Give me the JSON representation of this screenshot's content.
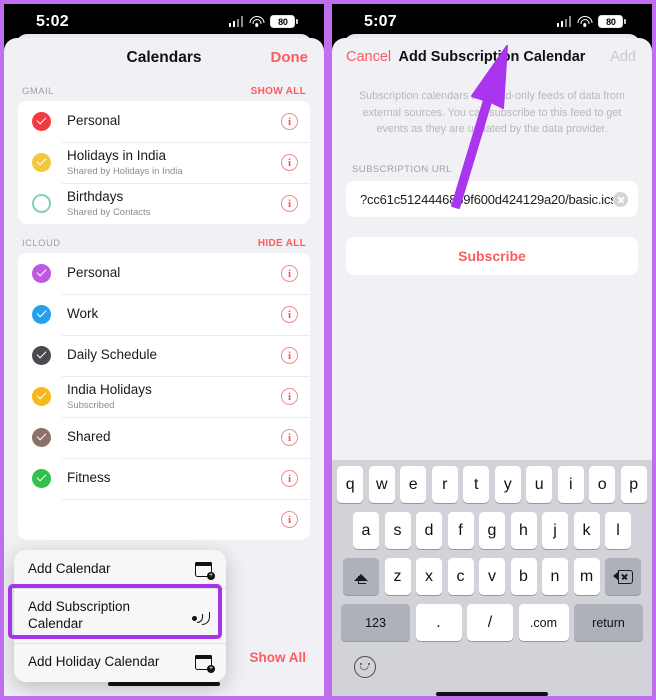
{
  "left": {
    "status": {
      "time": "5:02",
      "battery": "80"
    },
    "nav": {
      "title": "Calendars",
      "done": "Done"
    },
    "sections": [
      {
        "label": "GMAIL",
        "action": "SHOW ALL",
        "rows": [
          {
            "name": "Personal",
            "sub": "",
            "color": "#f33a3f",
            "checked": true
          },
          {
            "name": "Holidays in India",
            "sub": "Shared by Holidays in India",
            "color": "#f2c83c",
            "checked": true
          },
          {
            "name": "Birthdays",
            "sub": "Shared by Contacts",
            "color": "#7fd1bd",
            "checked": false
          }
        ]
      },
      {
        "label": "ICLOUD",
        "action": "HIDE ALL",
        "rows": [
          {
            "name": "Personal",
            "sub": "",
            "color": "#bd5ae0",
            "checked": true
          },
          {
            "name": "Work",
            "sub": "",
            "color": "#22a1ef",
            "checked": true
          },
          {
            "name": "Daily Schedule",
            "sub": "",
            "color": "#4b4b4f",
            "checked": true
          },
          {
            "name": "India Holidays",
            "sub": "Subscribed",
            "color": "#f5b91c",
            "checked": true
          },
          {
            "name": "Shared",
            "sub": "",
            "color": "#8a7268",
            "checked": true
          },
          {
            "name": "Fitness",
            "sub": "",
            "color": "#2fc14a",
            "checked": true
          }
        ]
      }
    ],
    "context_menu": [
      {
        "label": "Add Calendar",
        "icon": "calendar-plus-icon"
      },
      {
        "label": "Add Subscription Calendar",
        "icon": "rss-feed-icon",
        "highlighted": true
      },
      {
        "label": "Add Holiday Calendar",
        "icon": "calendar-plus-icon"
      }
    ],
    "footer": {
      "add_calendar": "Add Calendar",
      "show_all": "Show All"
    },
    "info_glyph": "i"
  },
  "right": {
    "status": {
      "time": "5:07",
      "battery": "80"
    },
    "nav": {
      "cancel": "Cancel",
      "title": "Add Subscription Calendar",
      "add": "Add"
    },
    "blurb": "Subscription calendars are read-only feeds of data from external sources. You can subscribe to this feed to get events as they are updated by the data provider.",
    "field_label": "SUBSCRIPTION URL",
    "url_value": "?cc61c5124446869f600d424129a20/basic.ics",
    "subscribe": "Subscribe",
    "keyboard": {
      "row1": [
        "q",
        "w",
        "e",
        "r",
        "t",
        "y",
        "u",
        "i",
        "o",
        "p"
      ],
      "row2": [
        "a",
        "s",
        "d",
        "f",
        "g",
        "h",
        "j",
        "k",
        "l"
      ],
      "row3": [
        "z",
        "x",
        "c",
        "v",
        "b",
        "n",
        "m"
      ],
      "shift": "shift-icon",
      "backspace": "backspace-icon",
      "numbers": "123",
      "period": ".",
      "slash": "/",
      "dotcom": ".com",
      "return": "return",
      "emoji": "emoji-icon"
    }
  },
  "accent": {
    "highlight": "#a635ea",
    "cursor": "#a935ee",
    "red": "#ff5a5f"
  }
}
